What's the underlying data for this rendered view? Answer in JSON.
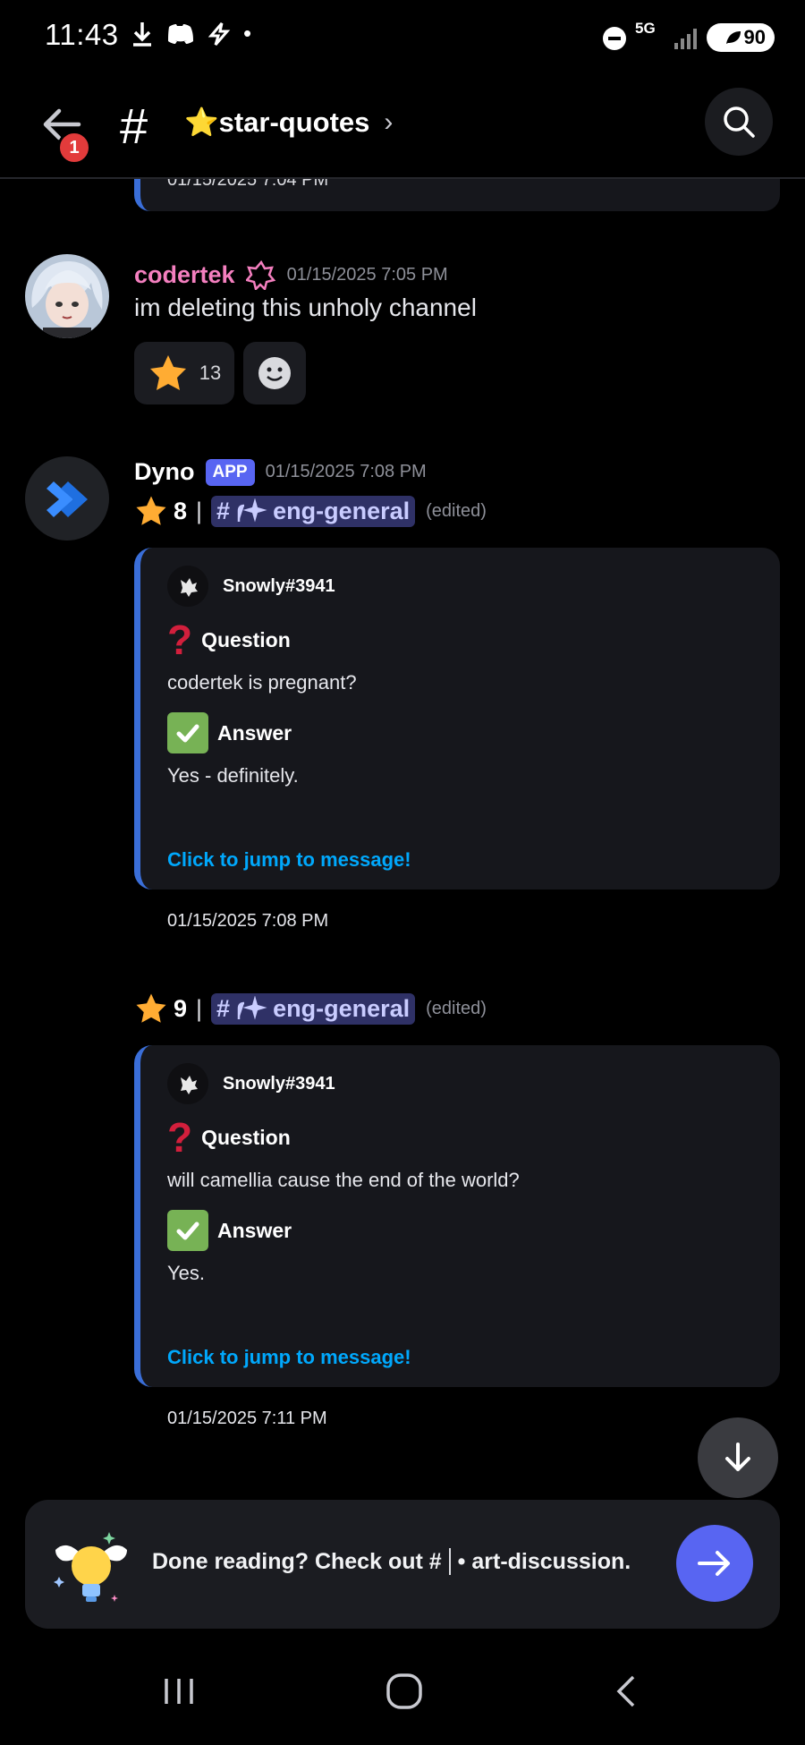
{
  "status_bar": {
    "time": "11:43",
    "network": "5G",
    "battery": "90"
  },
  "header": {
    "notification_count": "1",
    "channel_hash": "#",
    "channel_name": "⭐star-quotes",
    "chevron": "›"
  },
  "previous_embed": {
    "timestamp": "01/15/2025 7:04 PM"
  },
  "messages": [
    {
      "author": "codertek",
      "author_color": "#f47fbf",
      "timestamp": "01/15/2025 7:05 PM",
      "text": "im deleting this unholy channel",
      "reactions": [
        {
          "emoji": "star",
          "count": "13"
        }
      ]
    },
    {
      "author": "Dyno",
      "app_badge": "APP",
      "timestamp": "01/15/2025 7:08 PM",
      "starboard_posts": [
        {
          "star_count": "8",
          "separator": "|",
          "channel_mention": "eng-general",
          "edited": "(edited)",
          "embed": {
            "author": "Snowly#3941",
            "question_label": "Question",
            "question": "codertek is pregnant?",
            "answer_label": "Answer",
            "answer": "Yes - definitely.",
            "jump_link": "Click to jump to message!",
            "timestamp": "01/15/2025 7:08 PM"
          }
        },
        {
          "star_count": "9",
          "separator": "|",
          "channel_mention": "eng-general",
          "edited": "(edited)",
          "embed": {
            "author": "Snowly#3941",
            "question_label": "Question",
            "question": "will camellia cause the end of the world?",
            "answer_label": "Answer",
            "answer": "Yes.",
            "jump_link": "Click to jump to message!",
            "timestamp": "01/15/2025 7:11 PM"
          }
        }
      ]
    }
  ],
  "suggestion": {
    "text_prefix": "Done reading? Check out #",
    "text_suffix": "• art-discussion."
  },
  "colors": {
    "accent": "#5865f2",
    "link": "#00a8fc",
    "embed_border": "#3a6ed8",
    "mention_bg": "#2f3166"
  }
}
